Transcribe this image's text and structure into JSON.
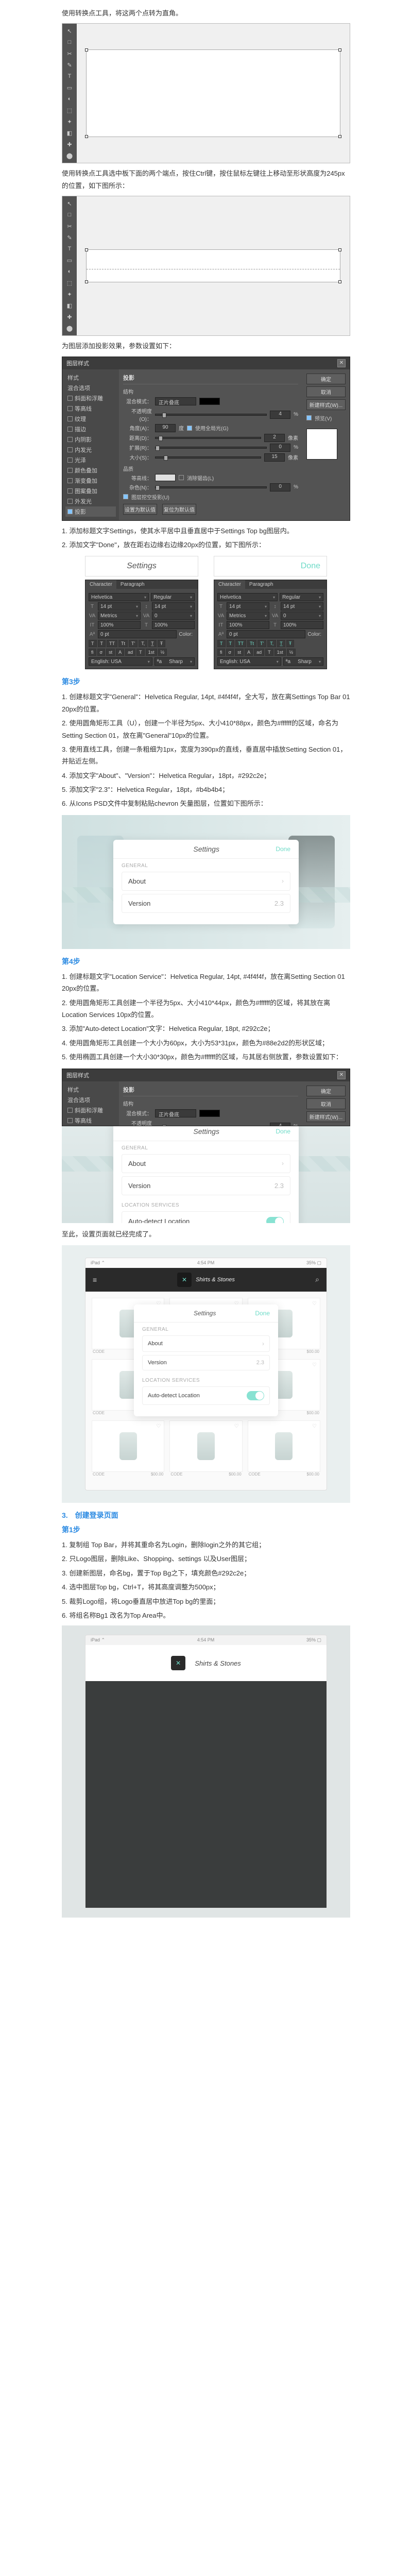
{
  "intro1": "使用转换点工具，将这两个点转为直角。",
  "intro2": "使用转换点工具选中板下面的两个端点，按住Ctrl键，按住鼠标左键往上移动至形状高度为245px的位置，如下图所示：",
  "intro3": "为图层添加投影效果，参数设置如下：",
  "ps": {
    "tools": [
      "↖",
      "□",
      "◫",
      "✎",
      "T",
      "▭",
      "◐",
      "✂",
      "✦",
      "⬚",
      "◧",
      "◨",
      "✚",
      "⬤",
      "◩"
    ],
    "title": "图层样式",
    "close": "✕",
    "left": {
      "header": "样式",
      "rows": [
        "混合选项",
        "斜面和浮雕",
        "等高线",
        "纹理",
        "描边",
        "内阴影",
        "内发光",
        "光泽",
        "颜色叠加",
        "渐变叠加",
        "图案叠加",
        "外发光",
        "投影"
      ]
    },
    "mid": {
      "h": "投影",
      "struct": "结构",
      "blend": "混合模式：",
      "blend_v": "正片叠底",
      "opacity": "不透明度(O)：",
      "opacity_v": "4",
      "pct": "%",
      "angle": "角度(A)：",
      "angle_v": "90",
      "deg": "度",
      "global": "使用全局光(G)",
      "dist": "距离(D)：",
      "dist_v": "2",
      "px": "像素",
      "spread": "扩展(R)：",
      "spread_v": "0",
      "size": "大小(S)：",
      "size_v": "15",
      "quality": "品质",
      "contour": "等高线：",
      "anti": "消除锯齿(L)",
      "noise": "杂色(N)：",
      "noise_v": "0",
      "knock": "图层挖空投影(U)",
      "btn_default": "设置为默认值",
      "btn_reset": "复位为默认值"
    },
    "right": [
      "确定",
      "取消",
      "新建样式(W)...",
      "预览(V)"
    ]
  },
  "afterDialog": [
    "1. 添加标题文字Settings，使其水平居中且垂直居中于Settings Top bg图层内。",
    "2. 添加文字\"Done\"，放在距右边缘右边缘20px的位置，如下图所示："
  ],
  "char": {
    "settings_word": "Settings",
    "done_word": "Done",
    "tab1": "Character",
    "tab2": "Paragraph",
    "font": "Helvetica",
    "weight_reg": "Regular",
    "sz14": "14 pt",
    "lh14": "14 pt",
    "va": "VA",
    "va_metrics": "Metrics",
    "va_0": "0",
    "it": "IT",
    "pct100": "100%",
    "aa0": "0 pt",
    "color": "Color:",
    "styleset": [
      "T",
      "T",
      "TT",
      "Tt",
      "T꜀",
      "T.",
      "T̲",
      "Ŧ"
    ],
    "lang_en": "English: USA",
    "aa_sharp": "Sharp"
  },
  "step3": {
    "title": "第3步",
    "lines": [
      "1. 创建标题文字\"General\"：Helvetica Regular, 14pt, #4f4f4f，全大写，放在离Settings Top Bar 01 20px的位置。",
      "2. 使用圆角矩形工具（U），创建一个半径为5px、大小410*88px，颜色为#ffffff的区域，命名为Setting Section 01，放在离\"General\"10px的位置。",
      "3. 使用直线工具，创建一条粗细为1px，宽度为390px的直线，垂直居中插放Setting Section 01，并贴近左侧。",
      "4. 添加文字\"About\"、\"Version\"：Helvetica Regular，18pt，#292c2e；",
      "5. 添加文字\"2.3\"：Helvetica Regular，18pt，#b4b4b4；",
      "6. 从Icons PSD文件中复制粘贴chevron 矢量图层，位置如下图所示："
    ]
  },
  "card": {
    "title": "Settings",
    "done": "Done",
    "general": "GENERAL",
    "about": "About",
    "version": "Version",
    "version_v": "2.3",
    "chev": "›",
    "loc": "LOCATION SERVICES",
    "auto": "Auto-detect Location"
  },
  "step4": {
    "title": "第4步",
    "lines": [
      "1. 创建标题文字\"Location Service\"：Helvetica Regular, 14pt, #4f4f4f，放在离Setting Section 01 20px的位置。",
      "2. 使用圆角矩形工具创建一个半径为5px、大小410*44px，颜色为#ffffff的区域，将其放在离Location Services 10px的位置。",
      "3. 添加\"Auto-detect Location\"文字：Helvetica Regular, 18pt, #292c2e；",
      "4. 使用圆角矩形工具创建一个大小为60px，大小为53*31px，颜色为#88e2d2的形状区域；",
      "5. 使用椭圆工具创建一个大小30*30px，颜色为#ffffff的区域，与其居右侧放置，参数设置如下："
    ]
  },
  "done1": "至此，设置页面就已经完成了。",
  "ipad": {
    "status_l": "iPad ⌃",
    "status_c": "4:54 PM",
    "status_r": "35% ▢",
    "ham": "≡",
    "search": "⌕",
    "brand": "Shirts & Stones",
    "cat_gen": "GENERAL",
    "cat_loc": "LOCATION SERVICES",
    "code": "CODE",
    "price": "$00.00"
  },
  "createLogin": {
    "title1": "3.　创建登录页面",
    "title2": "第1步",
    "lines": [
      "1. 复制组 Top Bar，并将其重命名为Login，删除login之外的其它组；",
      "2. 只Logo图层，删除Like、Shopping、settings 以及User图层；",
      "3. 创建新图层，命名bg，置于Top Bg之下，填充颜色#292c2e；",
      "4. 选中图层Top bg，Ctrl+T，将其高度调整为500px；",
      "5. 裁剪Logo组，将Logo垂直居中放进Top bg的里面；",
      "6. 将组名称Bg1 改名为Top Area中。"
    ]
  }
}
